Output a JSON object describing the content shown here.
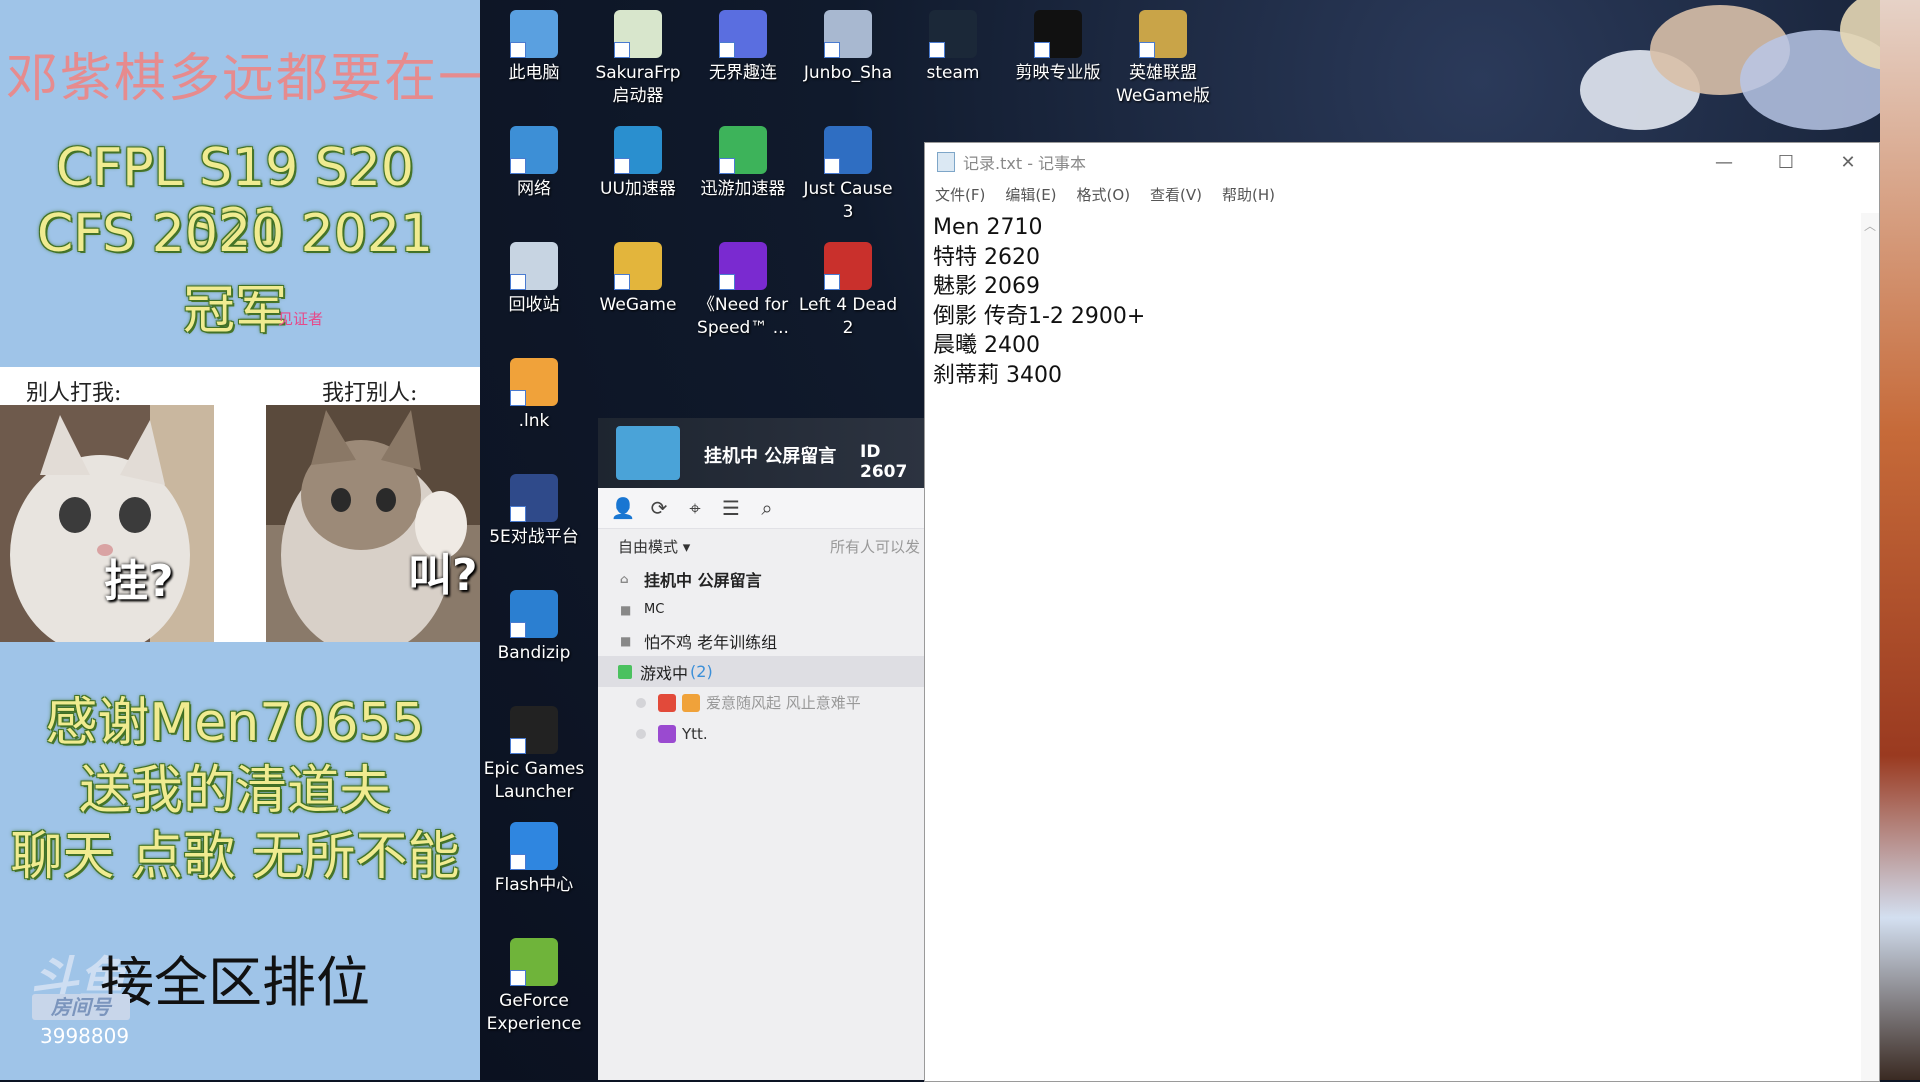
{
  "overlay": {
    "marquee": "邓紫棋多远都要在一",
    "titles": [
      "CFPL S19 S20 S21",
      "CFS  2020 2021",
      "冠军"
    ],
    "witness": "见证者",
    "cat_left_caption": "别人打我:",
    "cat_right_caption": "我打别人:",
    "cat_left_label": "挂?",
    "cat_right_label": "叫?",
    "thanks": [
      "感谢Men70655",
      "送我的清道夫",
      "聊天 点歌 无所不能"
    ],
    "ranked": "接全区排位",
    "platform_logo": "斗鱼",
    "room_badge": "房间号",
    "room_number": "3998809"
  },
  "desktop_icons": [
    {
      "label": "此电脑"
    },
    {
      "label": "SakuraFrp 启动器"
    },
    {
      "label": "无界趣连"
    },
    {
      "label": "Junbo_Sha"
    },
    {
      "label": "steam"
    },
    {
      "label": "剪映专业版"
    },
    {
      "label": "英雄联盟 WeGame版"
    },
    {
      "label": "网络"
    },
    {
      "label": "UU加速器"
    },
    {
      "label": "迅游加速器"
    },
    {
      "label": "Just Cause 3"
    },
    {
      "label": "回收站"
    },
    {
      "label": "WeGame"
    },
    {
      "label": "《Need for Speed™ ..."
    },
    {
      "label": "Left 4 Dead 2"
    },
    {
      "label": ".lnk"
    },
    {
      "label": "5E对战平台"
    },
    {
      "label": "Bandizip"
    },
    {
      "label": "Epic Games Launcher"
    },
    {
      "label": "Flash中心"
    },
    {
      "label": "GeForce Experience"
    }
  ],
  "voice": {
    "channel_title": "挂机中 公屏留言",
    "channel_id": "ID 2607",
    "mode": "自由模式",
    "hint": "所有人可以发",
    "channels": [
      {
        "name": "挂机中  公屏留言"
      },
      {
        "name": "MC"
      },
      {
        "name": "怕不鸡 老年训练组"
      }
    ],
    "active_channel": "游戏中",
    "active_count": "(2)",
    "users": [
      "爱意随风起 风止意难平",
      "Ytt."
    ]
  },
  "notepad": {
    "title": "记录.txt - 记事本",
    "menu": [
      "文件(F)",
      "编辑(E)",
      "格式(O)",
      "查看(V)",
      "帮助(H)"
    ],
    "lines": [
      "Men 2710",
      "特特 2620",
      "魅影 2069",
      "倒影 传奇1-2 2900+",
      "晨曦 2400",
      "刹蒂莉 3400"
    ]
  },
  "colors": {
    "overlay_bg": "#9fc4e8",
    "glow_text": "#f0eb90",
    "marquee": "#f3827f"
  }
}
